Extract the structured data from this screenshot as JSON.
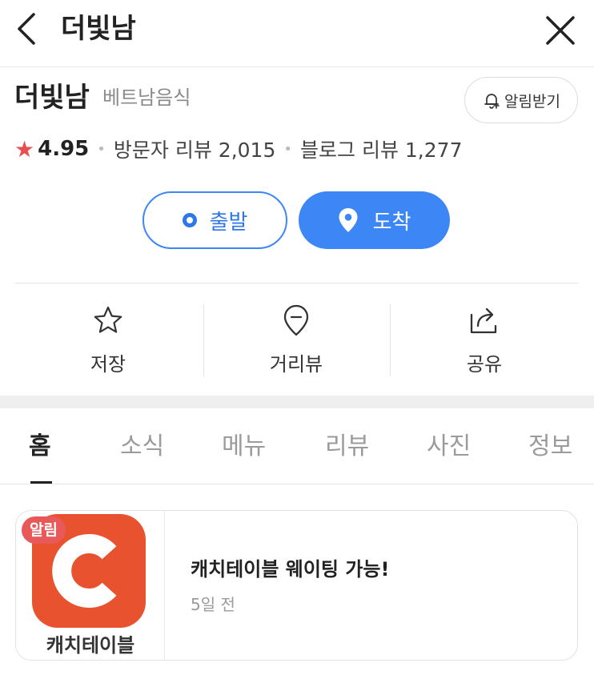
{
  "header": {
    "title": "더빛남"
  },
  "place": {
    "name": "더빛남",
    "category": "베트남음식",
    "alarm_label": "알림받기",
    "rating": "4.95",
    "visitor_review_label": "방문자 리뷰",
    "visitor_review_count": "2,015",
    "blog_review_label": "블로그 리뷰",
    "blog_review_count": "1,277",
    "rating_color": "#e8504f"
  },
  "route": {
    "start_label": "출발",
    "end_label": "도착",
    "accent_color": "#3d86f5"
  },
  "actions": [
    {
      "label": "저장",
      "icon": "star-outline-icon"
    },
    {
      "label": "거리뷰",
      "icon": "map-pin-minus-icon"
    },
    {
      "label": "공유",
      "icon": "share-icon"
    }
  ],
  "tabs": [
    {
      "label": "홈",
      "active": true
    },
    {
      "label": "소식",
      "active": false
    },
    {
      "label": "메뉴",
      "active": false
    },
    {
      "label": "리뷰",
      "active": false
    },
    {
      "label": "사진",
      "active": false
    },
    {
      "label": "정보",
      "active": false
    }
  ],
  "notice": {
    "badge": "알림",
    "app_name": "캐치테이블",
    "title": "캐치테이블 웨이팅 가능!",
    "time": "5일 전",
    "logo_color": "#e8522e"
  }
}
